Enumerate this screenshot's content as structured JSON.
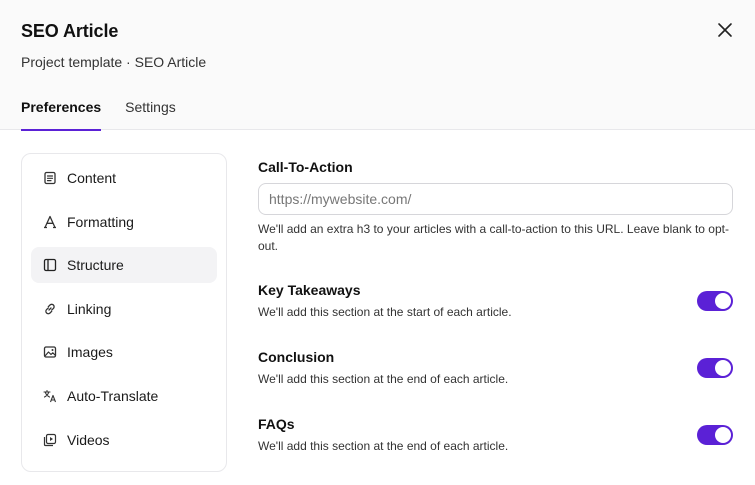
{
  "header": {
    "title": "SEO Article",
    "subtitle": "Project template · SEO Article"
  },
  "tabs": [
    {
      "label": "Preferences",
      "active": true
    },
    {
      "label": "Settings",
      "active": false
    }
  ],
  "sidebar": {
    "items": [
      {
        "label": "Content",
        "icon": "document-icon",
        "active": false
      },
      {
        "label": "Formatting",
        "icon": "font-icon",
        "active": false
      },
      {
        "label": "Structure",
        "icon": "layout-icon",
        "active": true
      },
      {
        "label": "Linking",
        "icon": "link-icon",
        "active": false
      },
      {
        "label": "Images",
        "icon": "images-icon",
        "active": false
      },
      {
        "label": "Auto-Translate",
        "icon": "translate-icon",
        "active": false
      },
      {
        "label": "Videos",
        "icon": "video-icon",
        "active": false
      }
    ]
  },
  "main": {
    "cta": {
      "label": "Call-To-Action",
      "placeholder": "https://mywebsite.com/",
      "value": "",
      "help": "We'll add an extra h3 to your articles with a call-to-action to this URL. Leave blank to opt-out."
    },
    "sections": [
      {
        "label": "Key Takeaways",
        "help": "We'll add this section at the start of each article.",
        "enabled": true
      },
      {
        "label": "Conclusion",
        "help": "We'll add this section at the end of each article.",
        "enabled": true
      },
      {
        "label": "FAQs",
        "help": "We'll add this section at the end of each article.",
        "enabled": true
      }
    ]
  },
  "colors": {
    "accent": "#5b21d6",
    "header_bg": "#fafafa",
    "border": "#e8e8eb",
    "active_item_bg": "#f3f3f5"
  }
}
